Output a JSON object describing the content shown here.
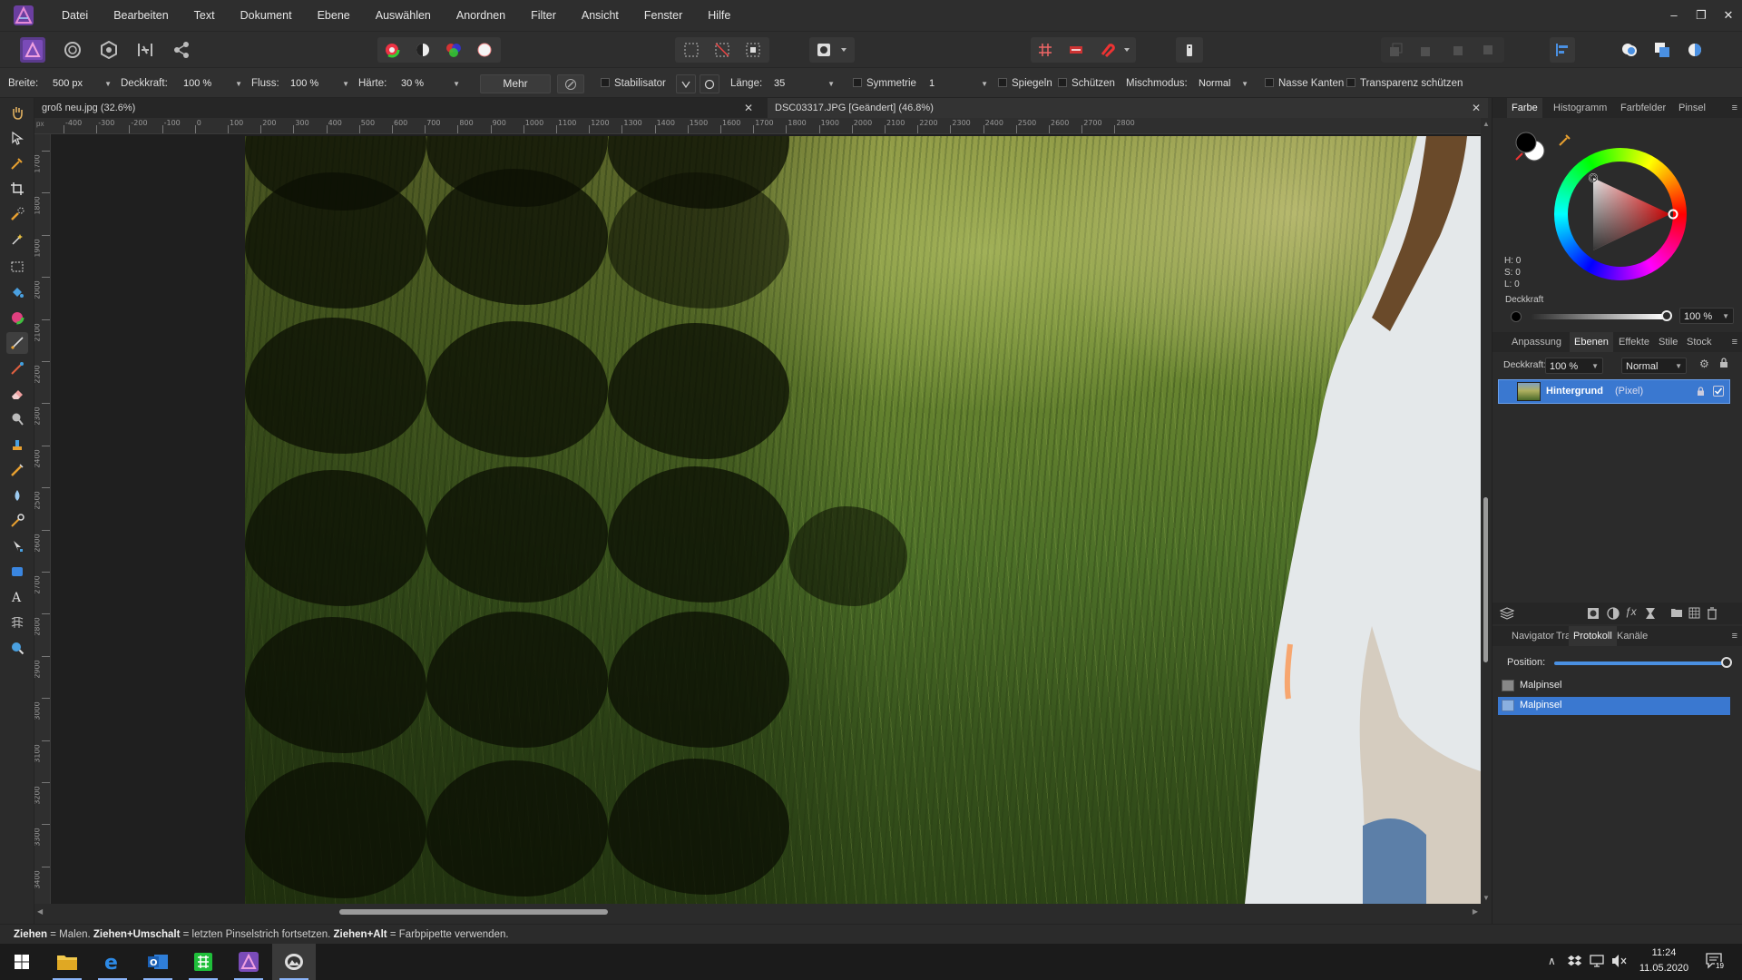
{
  "menubar": {
    "items": [
      "Datei",
      "Bearbeiten",
      "Text",
      "Dokument",
      "Ebene",
      "Auswählen",
      "Anordnen",
      "Filter",
      "Ansicht",
      "Fenster",
      "Hilfe"
    ],
    "window_controls": [
      "–",
      "❐",
      "✕"
    ]
  },
  "context_bar": {
    "breite_label": "Breite:",
    "breite_value": "500 px",
    "deckkraft_label": "Deckkraft:",
    "deckkraft_value": "100 %",
    "fluss_label": "Fluss:",
    "fluss_value": "100 %",
    "haerte_label": "Härte:",
    "haerte_value": "30 %",
    "mehr_label": "Mehr",
    "stabilisator_label": "Stabilisator",
    "laenge_label": "Länge:",
    "laenge_value": "35",
    "symmetrie_label": "Symmetrie",
    "symmetrie_value": "1",
    "spiegeln_label": "Spiegeln",
    "schuetzen_label": "Schützen",
    "mischmodus_label": "Mischmodus:",
    "mischmodus_value": "Normal",
    "nasse_kanten_label": "Nasse Kanten",
    "transparenz_label": "Transparenz schützen"
  },
  "documents": {
    "tab1": "groß neu.jpg (32.6%)",
    "tab2": "DSC03317.JPG [Geändert] (46.8%)",
    "close": "✕"
  },
  "rulers": {
    "unit": "px",
    "h_ticks": [
      "-400",
      "-300",
      "-200",
      "-100",
      "0",
      "100",
      "200",
      "300",
      "400",
      "500",
      "600",
      "700",
      "800",
      "900",
      "1000",
      "1100",
      "1200",
      "1300",
      "1400",
      "1500",
      "1600",
      "1700",
      "1800",
      "1900",
      "2000",
      "2100",
      "2200",
      "2300",
      "2400",
      "2500",
      "2600",
      "2700",
      "2800"
    ],
    "v_ticks": [
      "1700",
      "1800",
      "1900",
      "2000",
      "2100",
      "2200",
      "2300",
      "2400",
      "2500",
      "2600",
      "2700",
      "2800",
      "2900",
      "3000",
      "3100",
      "3200",
      "3300",
      "3400"
    ]
  },
  "color_panel": {
    "tabs": [
      "Farbe",
      "Histogramm",
      "Farbfelder",
      "Pinsel"
    ],
    "h": "H: 0",
    "s": "S: 0",
    "l": "L: 0",
    "opacity_label": "Deckkraft",
    "opacity_value": "100 %"
  },
  "layers_panel": {
    "tabs": [
      "Anpassung",
      "Ebenen",
      "Effekte",
      "Stile",
      "Stock"
    ],
    "opacity_label": "Deckkraft:",
    "opacity_value": "100 %",
    "blend_value": "Normal",
    "layer_name": "Hintergrund",
    "layer_type": "(Pixel)"
  },
  "history_panel": {
    "tabs": [
      "Navigator",
      "Tra",
      "Protokoll",
      "Kanäle"
    ],
    "position_label": "Position:",
    "position_fraction": 1.0,
    "entries": [
      "Malpinsel",
      "Malpinsel"
    ]
  },
  "hint": {
    "k1": "Ziehen",
    "t1": " = Malen. ",
    "k2": "Ziehen+Umschalt",
    "t2": " = letzten Pinselstrich fortsetzen. ",
    "k3": "Ziehen+Alt",
    "t3": " = Farbpipette verwenden."
  },
  "taskbar": {
    "time": "11:24",
    "date": "11.05.2020",
    "notifications": "19"
  },
  "colors": {
    "accent": "#4a7fd6",
    "primary_color": "#000000",
    "secondary_color": "#ffffff"
  }
}
